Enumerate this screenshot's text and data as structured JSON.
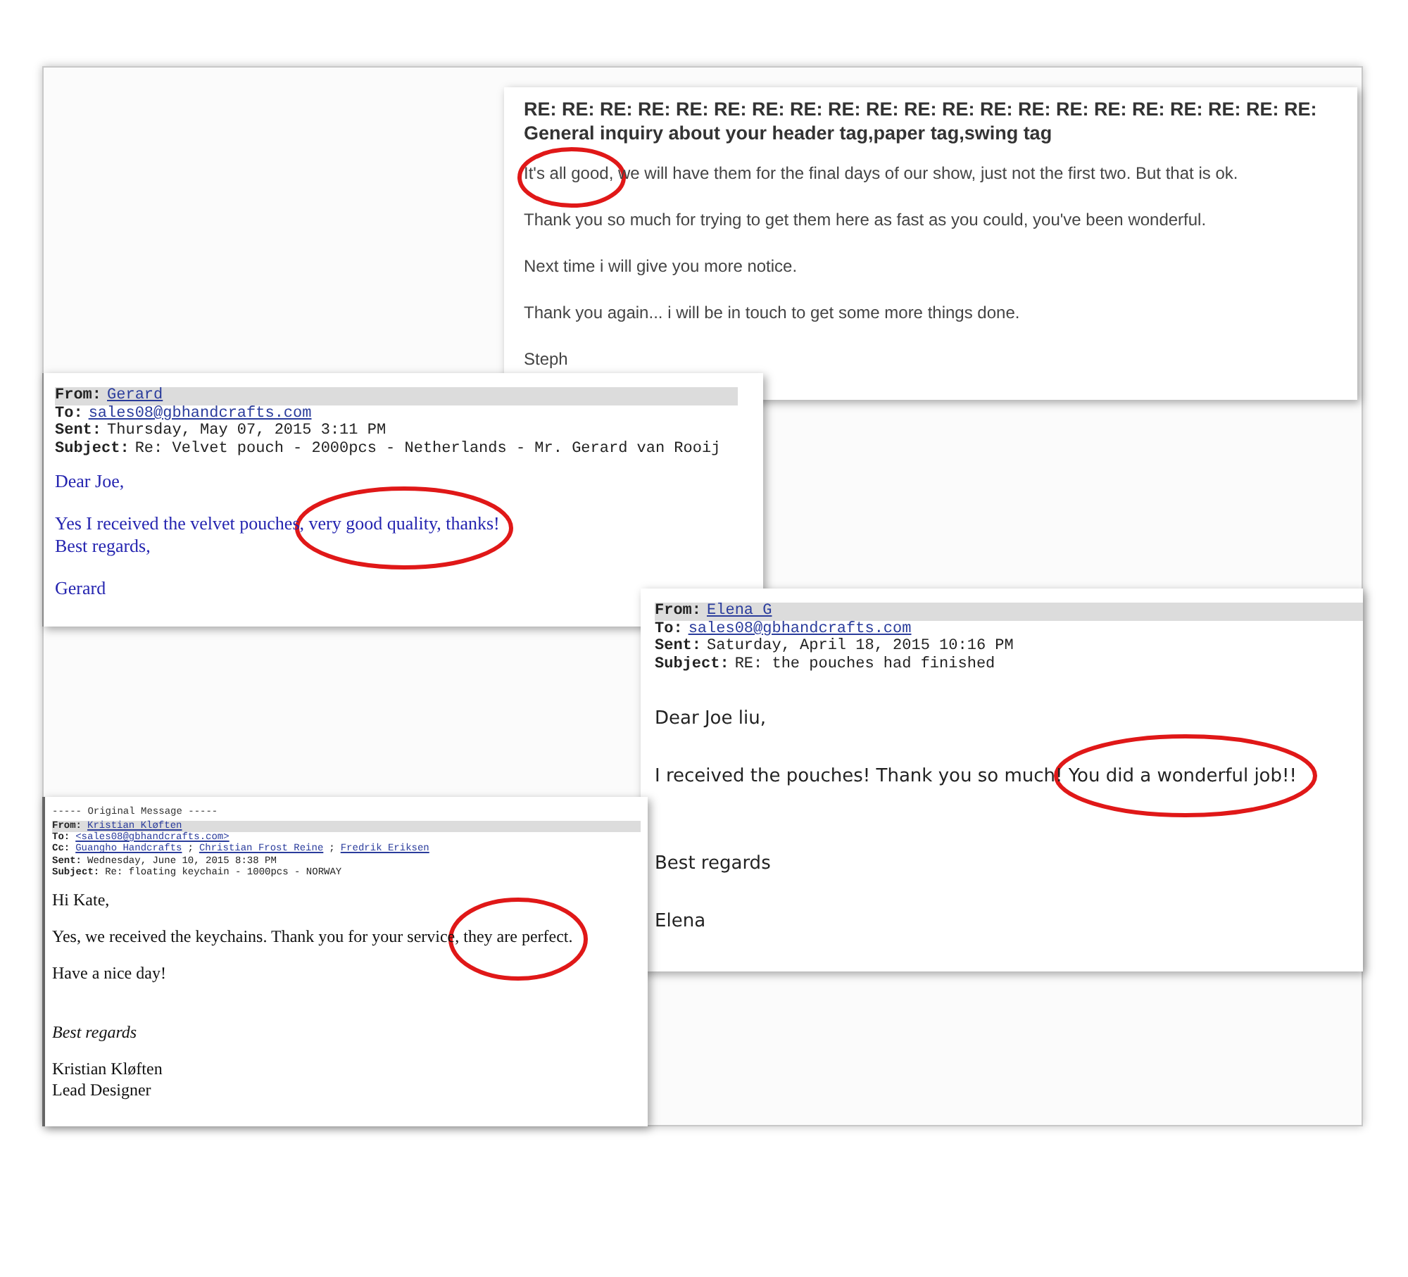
{
  "emails": [
    {
      "kind": "webmail",
      "subject": "RE: RE: RE: RE: RE: RE: RE: RE: RE: RE: RE: RE: RE: RE: RE: RE: RE: RE: RE: RE: RE: General inquiry about your header tag,paper tag,swing tag",
      "paragraphs": [
        {
          "lines": [
            "It's all good, we will have them for the final days of our show, just not the first two. But that is ok."
          ],
          "italic": false
        },
        {
          "lines": [
            "Thank you so much for trying to get them here as fast as you could, you've been wonderful."
          ],
          "italic": false
        },
        {
          "lines": [
            "Next time i will give you more notice."
          ],
          "italic": false
        },
        {
          "lines": [
            "Thank you again... i will be in touch to get some more things done."
          ],
          "italic": false
        },
        {
          "lines": [
            "Steph"
          ],
          "italic": false
        }
      ]
    },
    {
      "kind": "richtext",
      "headers": [
        {
          "label": "From:",
          "links": [
            "Gerard"
          ]
        },
        {
          "label": "To:",
          "links": [
            "sales08@gbhandcrafts.com"
          ]
        },
        {
          "label": "Sent:",
          "text": "Thursday, May 07, 2015 3:11 PM"
        },
        {
          "label": "Subject:",
          "text": "Re: Velvet pouch - 2000pcs - Netherlands - Mr. Gerard van Rooij"
        }
      ],
      "paragraphs": [
        {
          "lines": [
            "Dear Joe,"
          ],
          "italic": false
        },
        {
          "lines": [
            "Yes I received the velvet pouches, very good quality, thanks!",
            "Best regards,"
          ],
          "italic": false
        },
        {
          "lines": [
            "Gerard"
          ],
          "italic": false
        }
      ]
    },
    {
      "kind": "plaintext",
      "headers": [
        {
          "label": "From:",
          "links": [
            "Elena G"
          ]
        },
        {
          "label": "To:",
          "links": [
            "sales08@gbhandcrafts.com"
          ]
        },
        {
          "label": "Sent:",
          "text": "Saturday, April 18, 2015 10:16 PM"
        },
        {
          "label": "Subject:",
          "text": "RE: the pouches had finished"
        }
      ],
      "paragraphs": [
        {
          "lines": [
            "Dear Joe liu,"
          ],
          "italic": false
        },
        {
          "lines": [
            "I received the pouches! Thank you so much! You did a wonderful job!!"
          ],
          "italic": false
        },
        {
          "lines": [
            "Best regards"
          ],
          "italic": false
        },
        {
          "lines": [
            "Elena"
          ],
          "italic": false
        }
      ]
    },
    {
      "kind": "compact",
      "banner": "----- Original Message -----",
      "headers": [
        {
          "label": "From:",
          "links": [
            "Kristian Kløften"
          ]
        },
        {
          "label": "To:",
          "links": [
            "<sales08@gbhandcrafts.com>"
          ]
        },
        {
          "label": "Cc:",
          "links": [
            "Guangho Handcrafts",
            "Christian Frost Reine",
            "Fredrik Eriksen"
          ],
          "separator": ";"
        },
        {
          "label": "Sent:",
          "text": "Wednesday, June 10, 2015 8:38 PM"
        },
        {
          "label": "Subject:",
          "text": "Re: floating keychain - 1000pcs - NORWAY"
        }
      ],
      "paragraphs": [
        {
          "lines": [
            "Hi Kate,"
          ],
          "italic": false
        },
        {
          "lines": [
            "Yes, we received the keychains. Thank you for your service, they are perfect."
          ],
          "italic": false
        },
        {
          "lines": [
            "Have a nice day!"
          ],
          "italic": false
        },
        {
          "lines": [
            "Best regards"
          ],
          "italic": true
        },
        {
          "lines": [
            "Kristian Kløften",
            "Lead Designer"
          ],
          "italic": false
        }
      ]
    }
  ]
}
